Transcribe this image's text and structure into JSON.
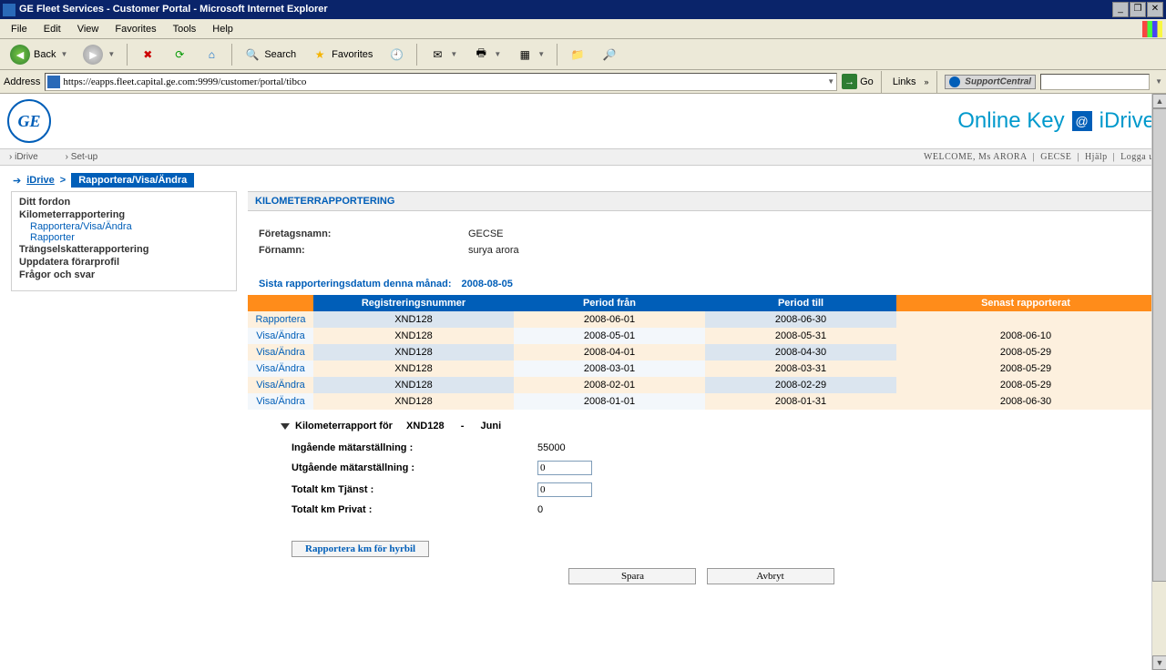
{
  "window": {
    "title": "GE Fleet Services - Customer Portal - Microsoft Internet Explorer"
  },
  "menu": {
    "items": [
      "File",
      "Edit",
      "View",
      "Favorites",
      "Tools",
      "Help"
    ]
  },
  "toolbar": {
    "back": "Back",
    "search": "Search",
    "favorites": "Favorites"
  },
  "addressbar": {
    "label": "Address",
    "url": "https://eapps.fleet.capital.ge.com:9999/customer/portal/tibco",
    "go": "Go",
    "links": "Links",
    "support": "SupportCentral"
  },
  "brand": {
    "online_key": "Online Key",
    "idrive": "iDrive"
  },
  "topnav": {
    "left": [
      "iDrive",
      "Set-up"
    ],
    "welcome": "WELCOME, Ms ARORA",
    "company": "GECSE",
    "help": "Hjälp",
    "logout": "Logga ut"
  },
  "breadcrumb": {
    "root": "iDrive",
    "sep": ">",
    "current": "Rapportera/Visa/Ändra"
  },
  "sidebar": {
    "items": [
      {
        "label": "Ditt fordon",
        "sub": []
      },
      {
        "label": "Kilometerrapportering",
        "sub": [
          "Rapportera/Visa/Ändra",
          "Rapporter"
        ]
      },
      {
        "label": "Trängselskatterapportering",
        "sub": []
      },
      {
        "label": "Uppdatera förarprofil",
        "sub": []
      },
      {
        "label": "Frågor och svar",
        "sub": []
      }
    ]
  },
  "panel": {
    "title": "KILOMETERRAPPORTERING",
    "company_label": "Företagsnamn:",
    "company_val": "GECSE",
    "name_label": "Förnamn:",
    "name_val": "surya arora",
    "last_report_label": "Sista rapporteringsdatum denna månad:",
    "last_report_val": "2008-08-05"
  },
  "table": {
    "headers": [
      "",
      "Registreringsnummer",
      "Period från",
      "Period till",
      "Senast rapporterat"
    ],
    "rows": [
      {
        "action": "Rapportera",
        "reg": "XND128",
        "from": "2008-06-01",
        "to": "2008-06-30",
        "last": ""
      },
      {
        "action": "Visa/Ändra",
        "reg": "XND128",
        "from": "2008-05-01",
        "to": "2008-05-31",
        "last": "2008-06-10"
      },
      {
        "action": "Visa/Ändra",
        "reg": "XND128",
        "from": "2008-04-01",
        "to": "2008-04-30",
        "last": "2008-05-29"
      },
      {
        "action": "Visa/Ändra",
        "reg": "XND128",
        "from": "2008-03-01",
        "to": "2008-03-31",
        "last": "2008-05-29"
      },
      {
        "action": "Visa/Ändra",
        "reg": "XND128",
        "from": "2008-02-01",
        "to": "2008-02-29",
        "last": "2008-05-29"
      },
      {
        "action": "Visa/Ändra",
        "reg": "XND128",
        "from": "2008-01-01",
        "to": "2008-01-31",
        "last": "2008-06-30"
      }
    ]
  },
  "detail": {
    "heading_prefix": "Kilometerrapport för",
    "reg": "XND128",
    "dash": "-",
    "month": "Juni",
    "in_odo_label": "Ingående mätarställning :",
    "in_odo_val": "55000",
    "out_odo_label": "Utgående mätarställning :",
    "out_odo_val": "0",
    "km_service_label": "Totalt km Tjänst :",
    "km_service_val": "0",
    "km_private_label": "Totalt km Privat :",
    "km_private_val": "0",
    "hire_btn": "Rapportera km för hyrbil",
    "save_btn": "Spara",
    "cancel_btn": "Avbryt"
  }
}
